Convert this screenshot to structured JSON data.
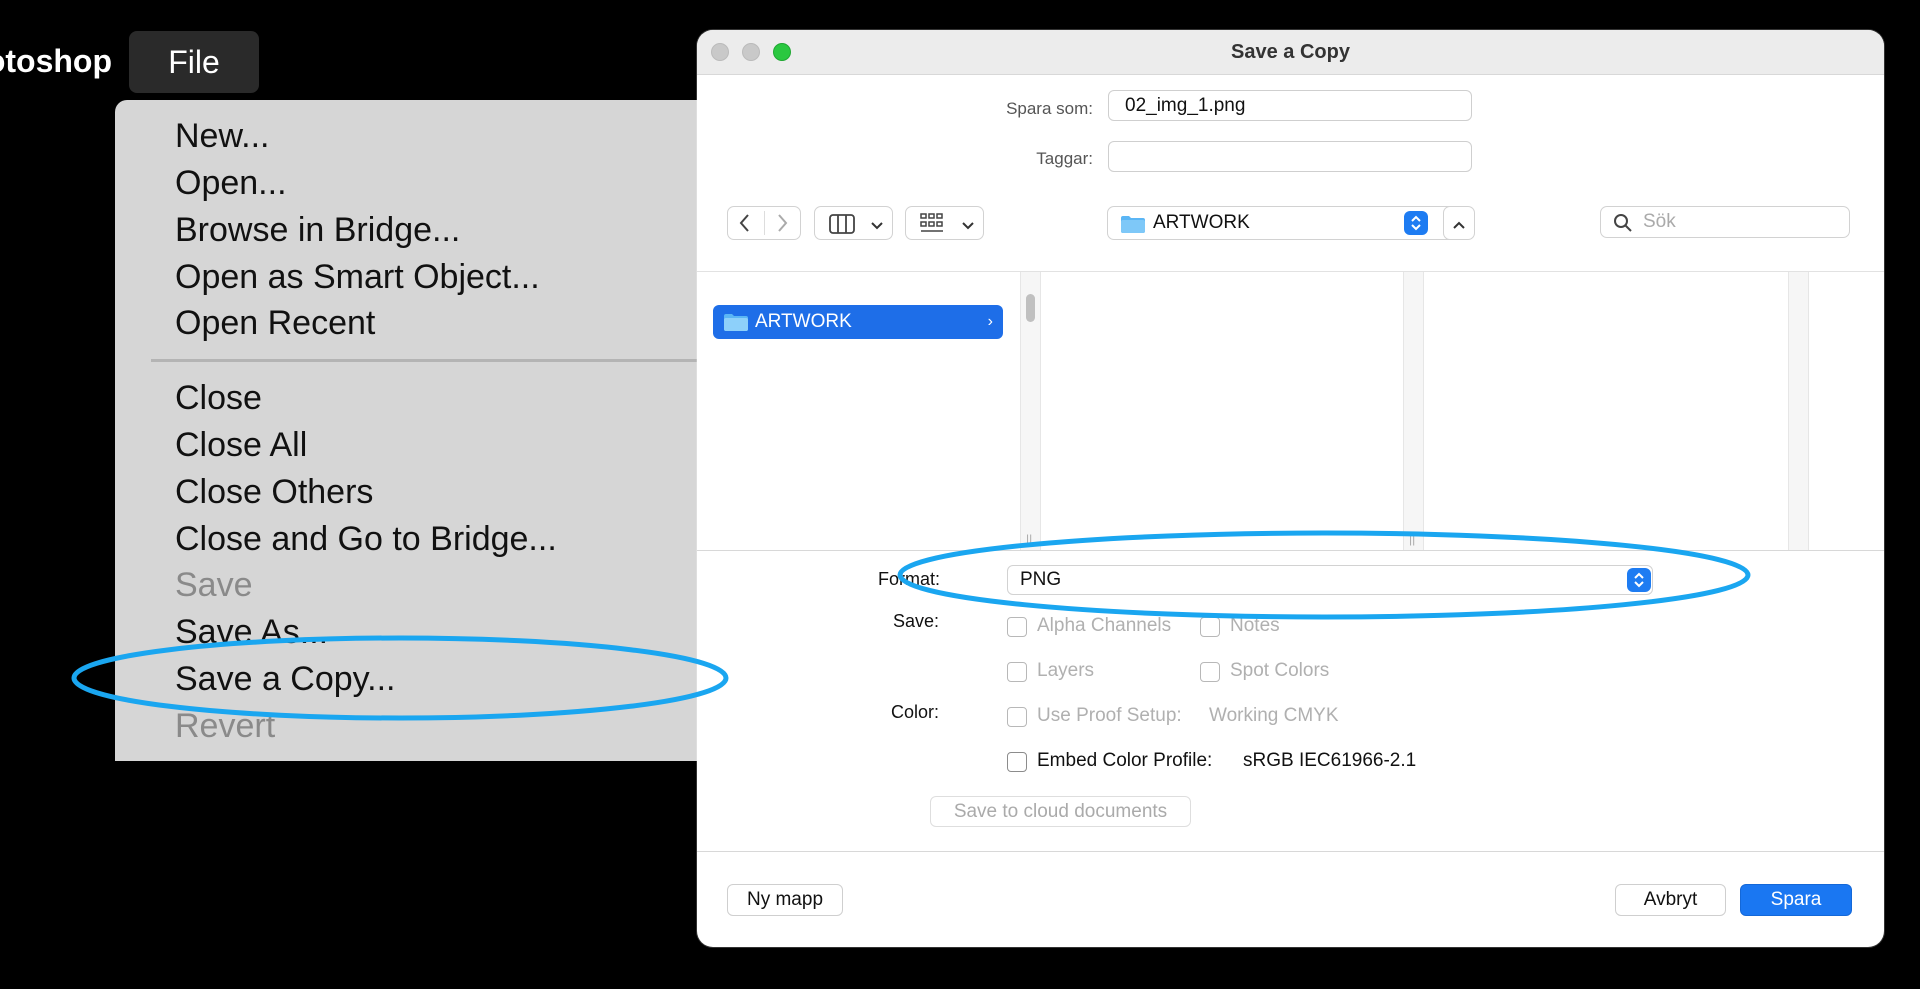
{
  "menubar": {
    "app_name": "Photoshop",
    "file_title": "File"
  },
  "file_menu": {
    "items": [
      {
        "label": "New...",
        "disabled": false
      },
      {
        "label": "Open...",
        "disabled": false
      },
      {
        "label": "Browse in Bridge...",
        "disabled": false
      },
      {
        "label": "Open as Smart Object...",
        "disabled": false
      },
      {
        "label": "Open Recent",
        "disabled": false
      },
      {
        "label": "Close",
        "disabled": false
      },
      {
        "label": "Close All",
        "disabled": false
      },
      {
        "label": "Close Others",
        "disabled": false
      },
      {
        "label": "Close and Go to Bridge...",
        "disabled": false
      },
      {
        "label": "Save",
        "disabled": true
      },
      {
        "label": "Save As...",
        "disabled": false
      },
      {
        "label": "Save a Copy...",
        "disabled": false
      },
      {
        "label": "Revert",
        "disabled": true
      }
    ]
  },
  "dialog": {
    "title": "Save a Copy",
    "save_as_label": "Spara som:",
    "save_as_value": "02_img_1.png",
    "tags_label": "Taggar:",
    "tags_value": "",
    "location": "ARTWORK",
    "search_placeholder": "Sök",
    "sidebar_item": "ARTWORK",
    "format_label": "Format:",
    "format_value": "PNG",
    "save_label": "Save:",
    "color_label": "Color:",
    "options": {
      "alpha_channels": "Alpha Channels",
      "notes": "Notes",
      "layers": "Layers",
      "spot_colors": "Spot Colors",
      "use_proof_setup": "Use Proof Setup:",
      "proof_value": "Working CMYK",
      "embed_color_profile": "Embed Color Profile:",
      "profile_value": "sRGB IEC61966-2.1"
    },
    "cloud_button": "Save to cloud documents",
    "new_folder_button": "Ny mapp",
    "cancel_button": "Avbryt",
    "save_button": "Spara"
  },
  "colors": {
    "accent": "#1a77f2",
    "annotation": "#1aa6f0",
    "traffic_green": "#2ac840"
  }
}
